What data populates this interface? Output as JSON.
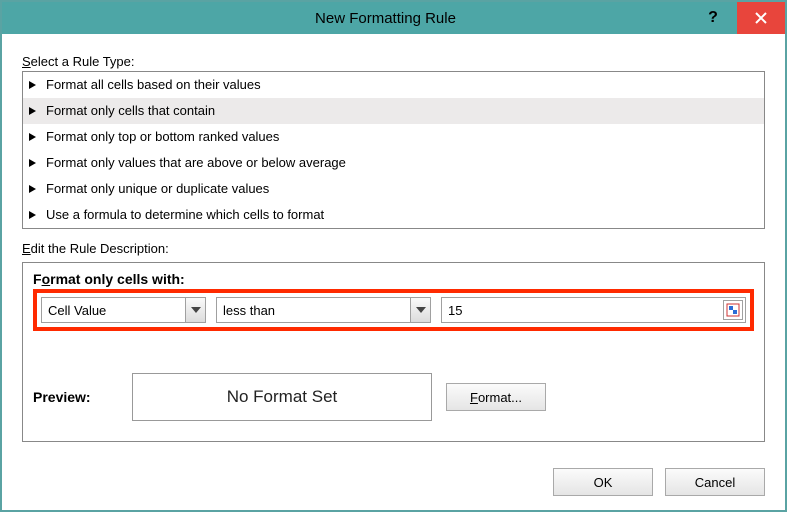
{
  "window": {
    "title": "New Formatting Rule"
  },
  "labels": {
    "select_rule_type_prefix": "S",
    "select_rule_type_rest": "elect a Rule Type:",
    "edit_desc_prefix": "E",
    "edit_desc_rest": "dit the Rule Description:",
    "format_only_prefix": "F",
    "format_only_mid": "o",
    "format_only_text": "Format only cells with:",
    "preview": "Preview:",
    "format_btn_prefix": "F",
    "format_btn_rest": "ormat...",
    "ok": "OK",
    "cancel": "Cancel"
  },
  "rule_types": [
    "Format all cells based on their values",
    "Format only cells that contain",
    "Format only top or bottom ranked values",
    "Format only values that are above or below average",
    "Format only unique or duplicate values",
    "Use a formula to determine which cells to format"
  ],
  "selected_rule_index": 1,
  "criteria": {
    "subject": "Cell Value",
    "operator": "less than",
    "value": "15"
  },
  "preview_text": "No Format Set"
}
